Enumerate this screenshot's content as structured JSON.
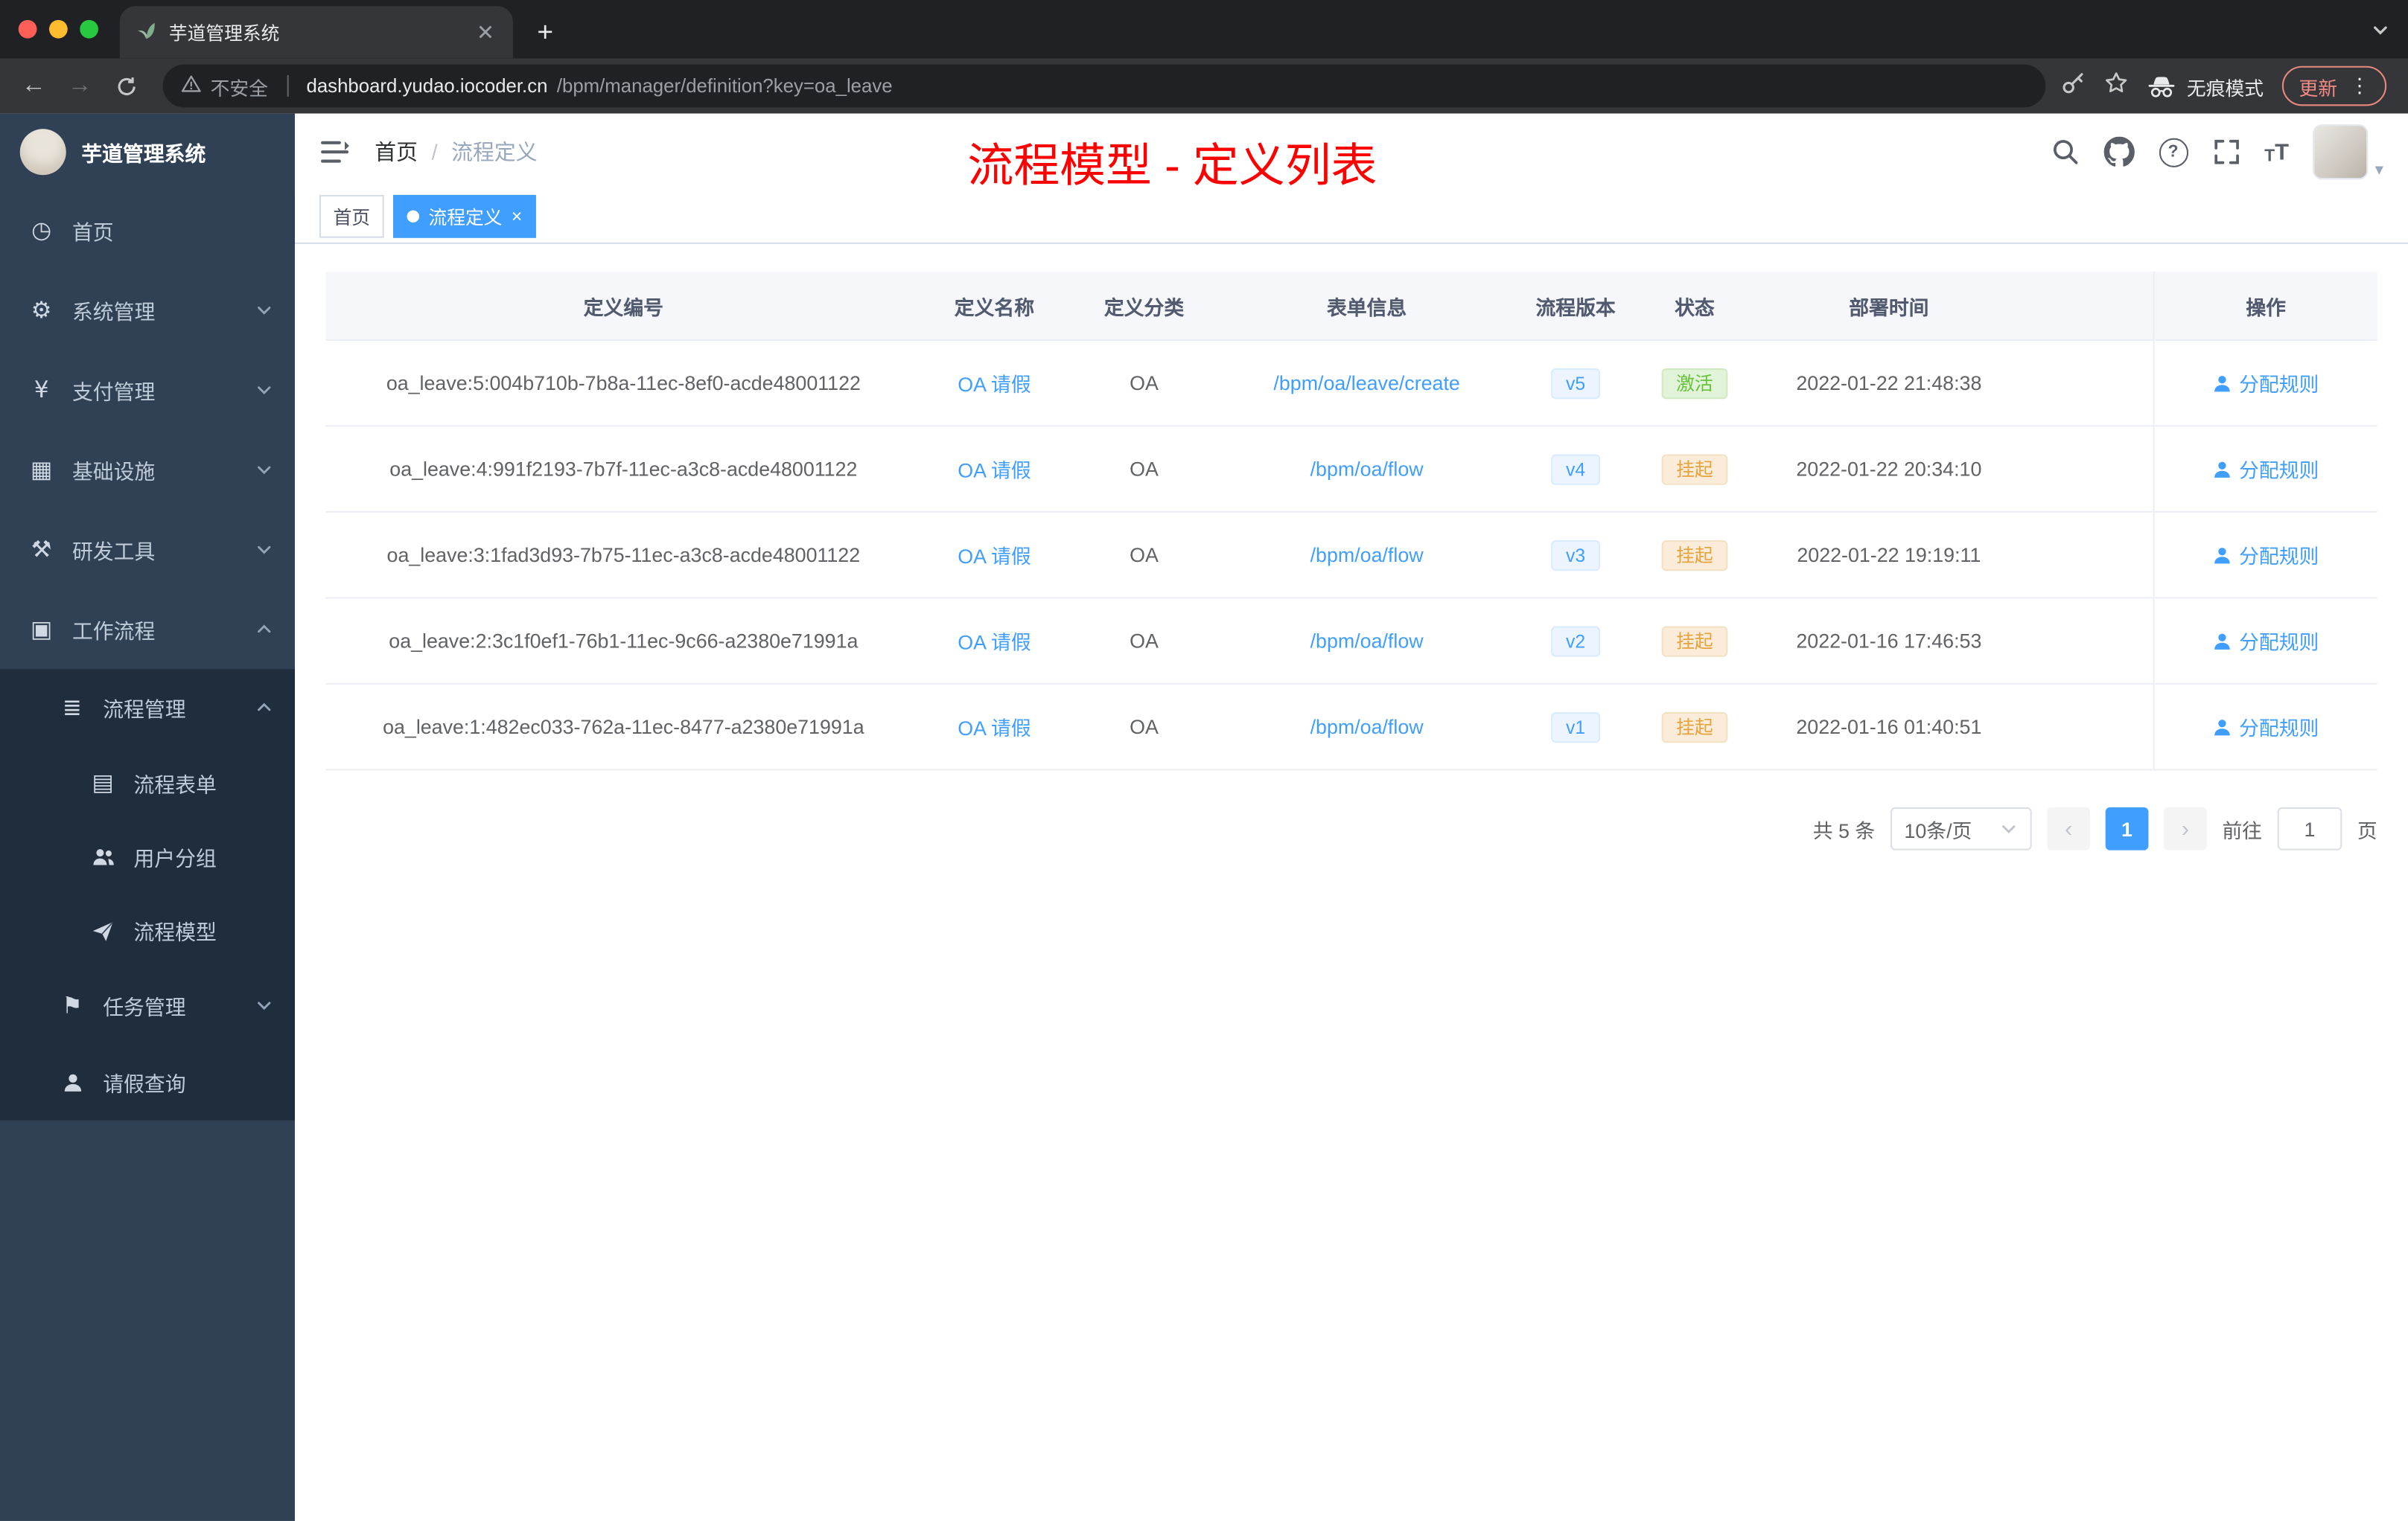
{
  "colors": {
    "accent": "#409eff",
    "annotation_red": "#fd0000",
    "success_green": "#67c23a",
    "warning_orange": "#e6a23c",
    "sidebar_bg": "#304156",
    "chrome_bg": "#202124"
  },
  "browser": {
    "tab": {
      "title": "芋道管理系统"
    },
    "nav": {
      "security": "不安全",
      "url_host": "dashboard.yudao.iocoder.cn",
      "url_path": "/bpm/manager/definition?key=oa_leave",
      "incognito": "无痕模式",
      "update": "更新"
    }
  },
  "icons": {
    "dashboard": "◷",
    "settings": "⚙",
    "payment": "¥",
    "infra": "▦",
    "tools": "⚒",
    "workflow": "▣",
    "process": "≣",
    "form": "▤",
    "task": "⚑"
  },
  "sidebar": {
    "brand": "芋道管理系统",
    "items": [
      {
        "label": "首页"
      },
      {
        "label": "系统管理"
      },
      {
        "label": "支付管理"
      },
      {
        "label": "基础设施"
      },
      {
        "label": "研发工具"
      },
      {
        "label": "工作流程"
      },
      {
        "label": "流程管理"
      },
      {
        "label": "流程表单"
      },
      {
        "label": "用户分组"
      },
      {
        "label": "流程模型"
      },
      {
        "label": "任务管理"
      },
      {
        "label": "请假查询"
      }
    ]
  },
  "header": {
    "breadcrumb": [
      "首页",
      "流程定义"
    ],
    "annotation": "流程模型 - 定义列表"
  },
  "tags": {
    "items": [
      {
        "label": "首页",
        "active": false
      },
      {
        "label": "流程定义",
        "active": true
      }
    ]
  },
  "table": {
    "headers": [
      "定义编号",
      "定义名称",
      "定义分类",
      "表单信息",
      "流程版本",
      "状态",
      "部署时间",
      "操作"
    ],
    "rows": [
      {
        "id": "oa_leave:5:004b710b-7b8a-11ec-8ef0-acde48001122",
        "name": "OA 请假",
        "category": "OA",
        "form": "/bpm/oa/leave/create",
        "version": "v5",
        "status": "激活",
        "time": "2022-01-22 21:48:38",
        "action": "分配规则"
      },
      {
        "id": "oa_leave:4:991f2193-7b7f-11ec-a3c8-acde48001122",
        "name": "OA 请假",
        "category": "OA",
        "form": "/bpm/oa/flow",
        "version": "v4",
        "status": "挂起",
        "time": "2022-01-22 20:34:10",
        "action": "分配规则"
      },
      {
        "id": "oa_leave:3:1fad3d93-7b75-11ec-a3c8-acde48001122",
        "name": "OA 请假",
        "category": "OA",
        "form": "/bpm/oa/flow",
        "version": "v3",
        "status": "挂起",
        "time": "2022-01-22 19:19:11",
        "action": "分配规则"
      },
      {
        "id": "oa_leave:2:3c1f0ef1-76b1-11ec-9c66-a2380e71991a",
        "name": "OA 请假",
        "category": "OA",
        "form": "/bpm/oa/flow",
        "version": "v2",
        "status": "挂起",
        "time": "2022-01-16 17:46:53",
        "action": "分配规则"
      },
      {
        "id": "oa_leave:1:482ec033-762a-11ec-8477-a2380e71991a",
        "name": "OA 请假",
        "category": "OA",
        "form": "/bpm/oa/flow",
        "version": "v1",
        "status": "挂起",
        "time": "2022-01-16 01:40:51",
        "action": "分配规则"
      }
    ]
  },
  "pagination": {
    "total": "共 5 条",
    "page_size": "10条/页",
    "current": "1",
    "goto_label": "前往",
    "goto_value": "1",
    "goto_unit": "页"
  }
}
